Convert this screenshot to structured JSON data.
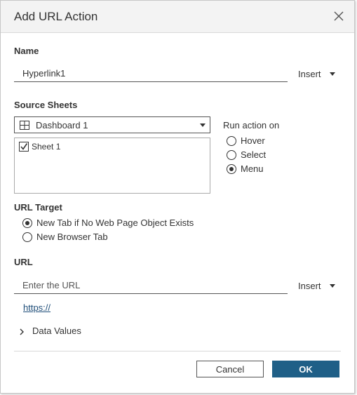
{
  "dialog": {
    "title": "Add URL Action"
  },
  "name": {
    "label": "Name",
    "value": "Hyperlink1",
    "insert_label": "Insert"
  },
  "source": {
    "label": "Source Sheets",
    "selected_sheet": "Dashboard 1",
    "sheets": [
      {
        "label": "Sheet 1",
        "checked": true
      }
    ]
  },
  "run_action": {
    "label": "Run action on",
    "options": [
      "Hover",
      "Select",
      "Menu"
    ],
    "selected": "Menu"
  },
  "url_target": {
    "label": "URL Target",
    "options": [
      "New Tab if No Web Page Object Exists",
      "New Browser Tab"
    ],
    "selected": "New Tab if No Web Page Object Exists"
  },
  "url": {
    "label": "URL",
    "placeholder": "Enter the URL",
    "insert_label": "Insert",
    "preview_link": "https://"
  },
  "data_values": {
    "label": "Data Values"
  },
  "buttons": {
    "cancel": "Cancel",
    "ok": "OK"
  },
  "colors": {
    "accent": "#1f5f87",
    "link": "#1f4e79",
    "titlebar": "#f3f3f3"
  },
  "icons": {
    "close": "close-icon",
    "sheet": "dashboard-grid-icon",
    "expand": "chevron-right-icon"
  }
}
